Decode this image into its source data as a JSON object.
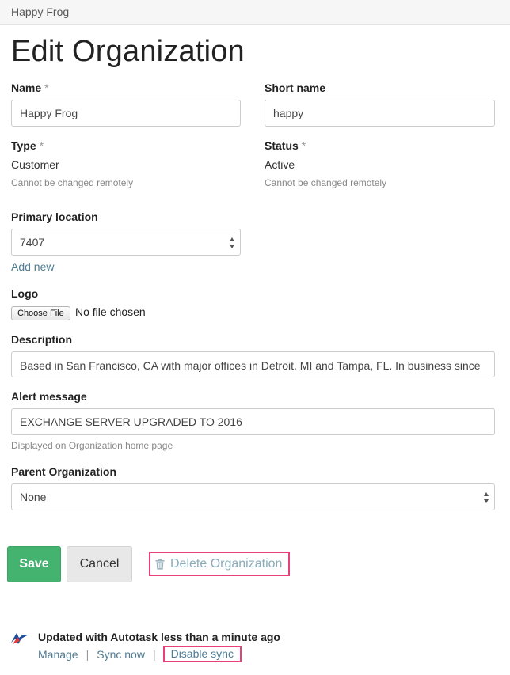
{
  "breadcrumb": "Happy Frog",
  "title": "Edit Organization",
  "fields": {
    "name": {
      "label": "Name",
      "required": "*",
      "value": "Happy Frog"
    },
    "short_name": {
      "label": "Short name",
      "value": "happy"
    },
    "type": {
      "label": "Type",
      "required": "*",
      "value": "Customer",
      "hint": "Cannot be changed remotely"
    },
    "status": {
      "label": "Status",
      "required": "*",
      "value": "Active",
      "hint": "Cannot be changed remotely"
    },
    "primary_location": {
      "label": "Primary location",
      "value": "7407",
      "add_new": "Add new"
    },
    "logo": {
      "label": "Logo",
      "button": "Choose File",
      "status": "No file chosen"
    },
    "description": {
      "label": "Description",
      "value": "Based in San Francisco, CA with major offices in Detroit. MI and Tampa, FL. In business since"
    },
    "alert_message": {
      "label": "Alert message",
      "value": "EXCHANGE SERVER UPGRADED TO 2016",
      "hint": "Displayed on Organization home page"
    },
    "parent_org": {
      "label": "Parent Organization",
      "value": "None"
    }
  },
  "actions": {
    "save": "Save",
    "cancel": "Cancel",
    "delete": "Delete Organization"
  },
  "sync": {
    "status": "Updated with Autotask less than a minute ago",
    "manage": "Manage",
    "sync_now": "Sync now",
    "disable": "Disable sync",
    "separator": "|"
  },
  "colors": {
    "link": "#4f7b93",
    "save": "#43b36f",
    "highlight": "#e8417a"
  },
  "icons": {
    "delete": "trash-icon",
    "sync": "autotask-logo-icon",
    "select": "select-arrows-icon"
  }
}
